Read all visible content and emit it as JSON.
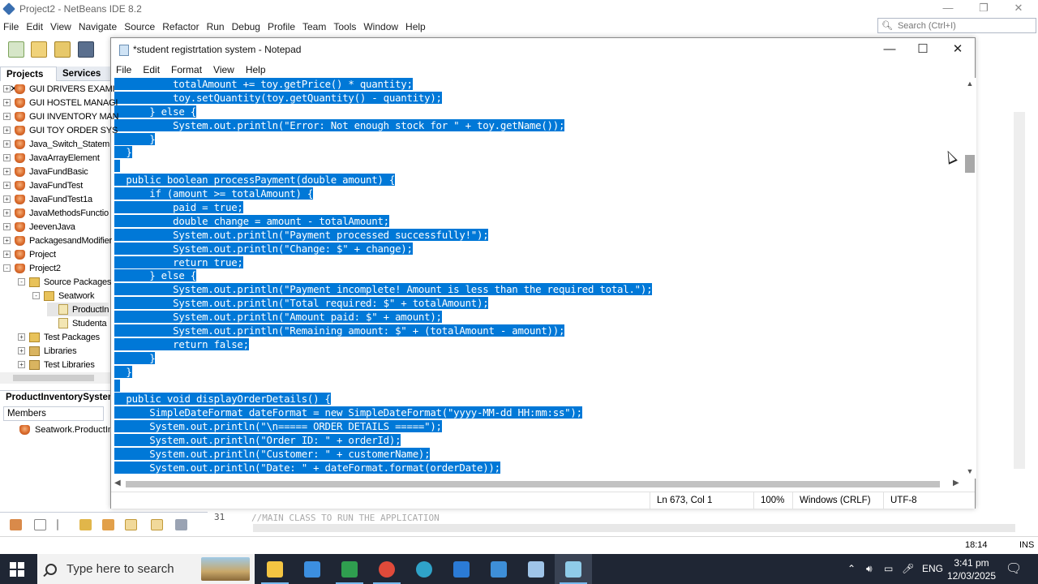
{
  "netbeans": {
    "title": "Project2 - NetBeans IDE 8.2",
    "menu": [
      "File",
      "Edit",
      "View",
      "Navigate",
      "Source",
      "Refactor",
      "Run",
      "Debug",
      "Profile",
      "Team",
      "Tools",
      "Window",
      "Help"
    ],
    "search_placeholder": "Search (Ctrl+I)",
    "tabs": {
      "projects": "Projects",
      "services": "Services"
    },
    "tree": [
      {
        "label": "GUI DRIVERS EXAMI",
        "icon": "project-cup-icon",
        "expander": "+"
      },
      {
        "label": "GUI HOSTEL MANAGI",
        "icon": "project-cup-icon",
        "expander": "+"
      },
      {
        "label": "GUI INVENTORY MAN",
        "icon": "project-cup-icon",
        "expander": "+"
      },
      {
        "label": "GUI TOY ORDER SYS",
        "icon": "project-cup-icon",
        "expander": "+"
      },
      {
        "label": "Java_Switch_Statem",
        "icon": "project-cup-icon",
        "expander": "+"
      },
      {
        "label": "JavaArrayElement",
        "icon": "project-cup-icon",
        "expander": "+"
      },
      {
        "label": "JavaFundBasic",
        "icon": "project-cup-icon",
        "expander": "+"
      },
      {
        "label": "JavaFundTest",
        "icon": "project-cup-icon",
        "expander": "+"
      },
      {
        "label": "JavaFundTest1a",
        "icon": "project-cup-icon",
        "expander": "+"
      },
      {
        "label": "JavaMethodsFunctio",
        "icon": "project-cup-icon",
        "expander": "+"
      },
      {
        "label": "JeevenJava",
        "icon": "project-cup-icon",
        "expander": "+"
      },
      {
        "label": "PackagesandModifier",
        "icon": "project-cup-icon",
        "expander": "+"
      },
      {
        "label": "Project",
        "icon": "project-cup-icon",
        "expander": "+"
      },
      {
        "label": "Project2",
        "icon": "project-cup-icon",
        "expander": "-"
      },
      {
        "label": "Source Packages",
        "icon": "package-folder-icon",
        "expander": "-"
      },
      {
        "label": "Seatwork",
        "icon": "package-icon",
        "expander": "-"
      },
      {
        "label": "ProductIn",
        "icon": "java-file-icon",
        "expander": ""
      },
      {
        "label": "Studenta",
        "icon": "java-file-icon",
        "expander": ""
      },
      {
        "label": "Test Packages",
        "icon": "package-folder-icon",
        "expander": "+"
      },
      {
        "label": "Libraries",
        "icon": "library-icon",
        "expander": "+"
      },
      {
        "label": "Test Libraries",
        "icon": "library-icon",
        "expander": "+"
      }
    ],
    "navigator_title": "ProductInventorySystem",
    "members_select": "Members",
    "member_item": "Seatwork.ProductIn",
    "editor_line_number": "31",
    "editor_line_code": "//MAIN CLASS TO RUN THE APPLICATION",
    "status_position": "18:14",
    "status_mode": "INS"
  },
  "notepad": {
    "title": "*student registrtation system - Notepad",
    "menu": [
      "File",
      "Edit",
      "Format",
      "View",
      "Help"
    ],
    "window_controls": {
      "minimize": "—",
      "maximize": "☐",
      "close": "✕"
    },
    "code_lines": [
      {
        "indent": "          ",
        "text": "totalAmount += toy.getPrice() * quantity;"
      },
      {
        "indent": "          ",
        "text": "toy.setQuantity(toy.getQuantity() - quantity);"
      },
      {
        "indent": "      ",
        "text": "} else {"
      },
      {
        "indent": "          ",
        "text": "System.out.println(\"Error: Not enough stock for \" + toy.getName());"
      },
      {
        "indent": "      ",
        "text": "}"
      },
      {
        "indent": "  ",
        "text": "}"
      },
      {
        "indent": "",
        "text": ""
      },
      {
        "indent": "  ",
        "text": "public boolean processPayment(double amount) {"
      },
      {
        "indent": "      ",
        "text": "if (amount >= totalAmount) {"
      },
      {
        "indent": "          ",
        "text": "paid = true;"
      },
      {
        "indent": "          ",
        "text": "double change = amount - totalAmount;"
      },
      {
        "indent": "          ",
        "text": "System.out.println(\"Payment processed successfully!\");"
      },
      {
        "indent": "          ",
        "text": "System.out.println(\"Change: $\" + change);"
      },
      {
        "indent": "          ",
        "text": "return true;"
      },
      {
        "indent": "      ",
        "text": "} else {"
      },
      {
        "indent": "          ",
        "text": "System.out.println(\"Payment incomplete! Amount is less than the required total.\");"
      },
      {
        "indent": "          ",
        "text": "System.out.println(\"Total required: $\" + totalAmount);"
      },
      {
        "indent": "          ",
        "text": "System.out.println(\"Amount paid: $\" + amount);"
      },
      {
        "indent": "          ",
        "text": "System.out.println(\"Remaining amount: $\" + (totalAmount - amount));"
      },
      {
        "indent": "          ",
        "text": "return false;"
      },
      {
        "indent": "      ",
        "text": "}"
      },
      {
        "indent": "  ",
        "text": "}"
      },
      {
        "indent": "",
        "text": ""
      },
      {
        "indent": "  ",
        "text": "public void displayOrderDetails() {"
      },
      {
        "indent": "      ",
        "text": "SimpleDateFormat dateFormat = new SimpleDateFormat(\"yyyy-MM-dd HH:mm:ss\");"
      },
      {
        "indent": "      ",
        "text": "System.out.println(\"\\n===== ORDER DETAILS =====\");"
      },
      {
        "indent": "      ",
        "text": "System.out.println(\"Order ID: \" + orderId);"
      },
      {
        "indent": "      ",
        "text": "System.out.println(\"Customer: \" + customerName);"
      },
      {
        "indent": "      ",
        "text": "System.out.println(\"Date: \" + dateFormat.format(orderDate));"
      }
    ],
    "status": {
      "position": "Ln 673, Col 1",
      "zoom": "100%",
      "line_ending": "Windows (CRLF)",
      "encoding": "UTF-8"
    },
    "selection_color": "#0078d7"
  },
  "taskbar": {
    "search_placeholder": "Type here to search",
    "apps": [
      {
        "name": "file-explorer-icon",
        "color": "#f4c542"
      },
      {
        "name": "store-icon",
        "color": "#3c8fe0"
      },
      {
        "name": "spreadsheet-icon",
        "color": "#2f9e4f"
      },
      {
        "name": "chrome-icon",
        "color": "#e04a3a"
      },
      {
        "name": "edge-icon",
        "color": "#2fa3c9"
      },
      {
        "name": "mail-icon",
        "color": "#2b7bd6"
      },
      {
        "name": "vs-code-icon",
        "color": "#3e8fd8"
      },
      {
        "name": "cube-app-icon",
        "color": "#9fc4e8"
      },
      {
        "name": "notepad-icon",
        "color": "#8fcbe8"
      }
    ],
    "language": "ENG",
    "time": "3:41 pm",
    "date": "12/03/2025"
  }
}
